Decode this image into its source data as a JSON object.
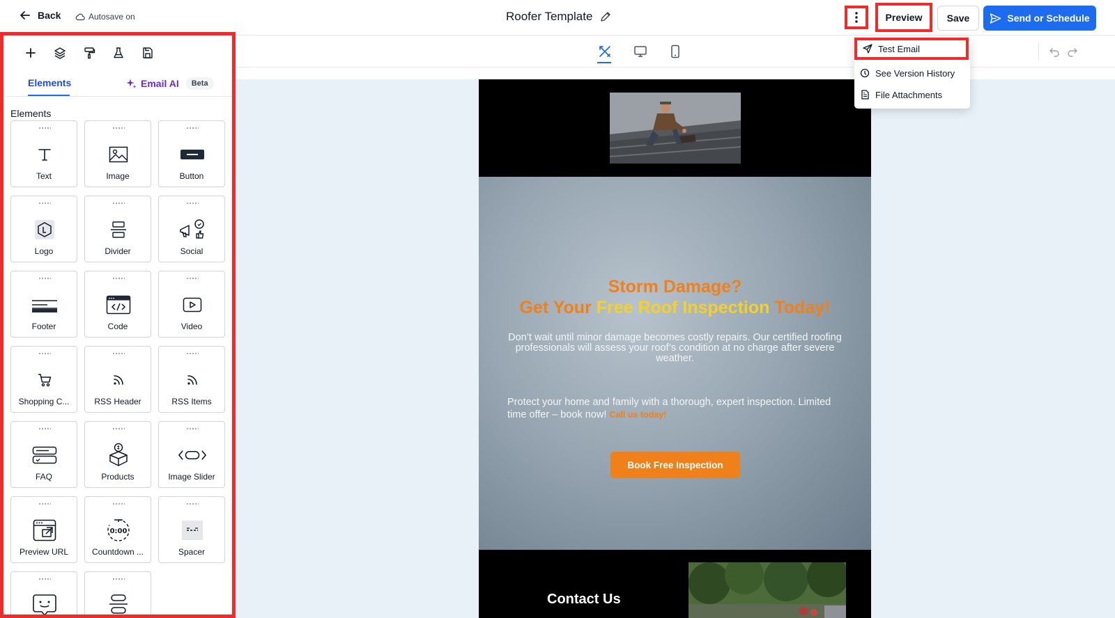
{
  "header": {
    "back_label": "Back",
    "autosave_label": "Autosave on",
    "title": "Roofer Template",
    "preview_label": "Preview",
    "save_label": "Save",
    "send_label": "Send or Schedule"
  },
  "more_menu": {
    "items": [
      {
        "label": "Test Email",
        "icon": "send-icon"
      },
      {
        "label": "See Version History",
        "icon": "history-icon"
      },
      {
        "label": "File Attachments",
        "icon": "file-icon"
      }
    ]
  },
  "sidebar": {
    "tabs": [
      {
        "label": "Elements"
      },
      {
        "label": "Email AI",
        "badge": "Beta"
      }
    ],
    "section_title": "Elements",
    "elements": [
      {
        "label": "Text",
        "icon": "text-icon"
      },
      {
        "label": "Image",
        "icon": "image-icon"
      },
      {
        "label": "Button",
        "icon": "button-icon"
      },
      {
        "label": "Logo",
        "icon": "logo-icon"
      },
      {
        "label": "Divider",
        "icon": "divider-icon"
      },
      {
        "label": "Social",
        "icon": "social-icon"
      },
      {
        "label": "Footer",
        "icon": "footer-icon"
      },
      {
        "label": "Code",
        "icon": "code-icon"
      },
      {
        "label": "Video",
        "icon": "video-icon"
      },
      {
        "label": "Shopping C...",
        "icon": "cart-icon"
      },
      {
        "label": "RSS Header",
        "icon": "rss-icon"
      },
      {
        "label": "RSS Items",
        "icon": "rss-icon"
      },
      {
        "label": "FAQ",
        "icon": "faq-icon"
      },
      {
        "label": "Products",
        "icon": "products-icon"
      },
      {
        "label": "Image Slider",
        "icon": "slider-icon"
      },
      {
        "label": "Preview URL",
        "icon": "preview-url-icon"
      },
      {
        "label": "Countdown ...",
        "icon": "countdown-icon"
      },
      {
        "label": "Spacer",
        "icon": "spacer-icon"
      },
      {
        "label": "",
        "icon": "chat-icon"
      },
      {
        "label": "",
        "icon": "stack-icon"
      }
    ]
  },
  "email": {
    "hero_line1": "Storm Damage?",
    "hero_line2_a": "Get Your ",
    "hero_line2_b": "Free Roof Inspection",
    "hero_line2_c": " Today!",
    "paragraph1": "Don’t wait until minor damage becomes costly repairs. Our certified roofing professionals will assess your roof’s condition at no charge after severe weather.",
    "paragraph2": "Protect your home and family with a thorough, expert inspection. Limited time offer – book now! ",
    "call_link": "Call us today!",
    "cta_label": "Book Free Inspection",
    "contact_heading": "Contact Us"
  },
  "colors": {
    "accent": "#1d6cf0",
    "highlight": "#ef2b2b",
    "brand_orange": "#f0801a",
    "brand_yellow": "#f5d02b"
  }
}
